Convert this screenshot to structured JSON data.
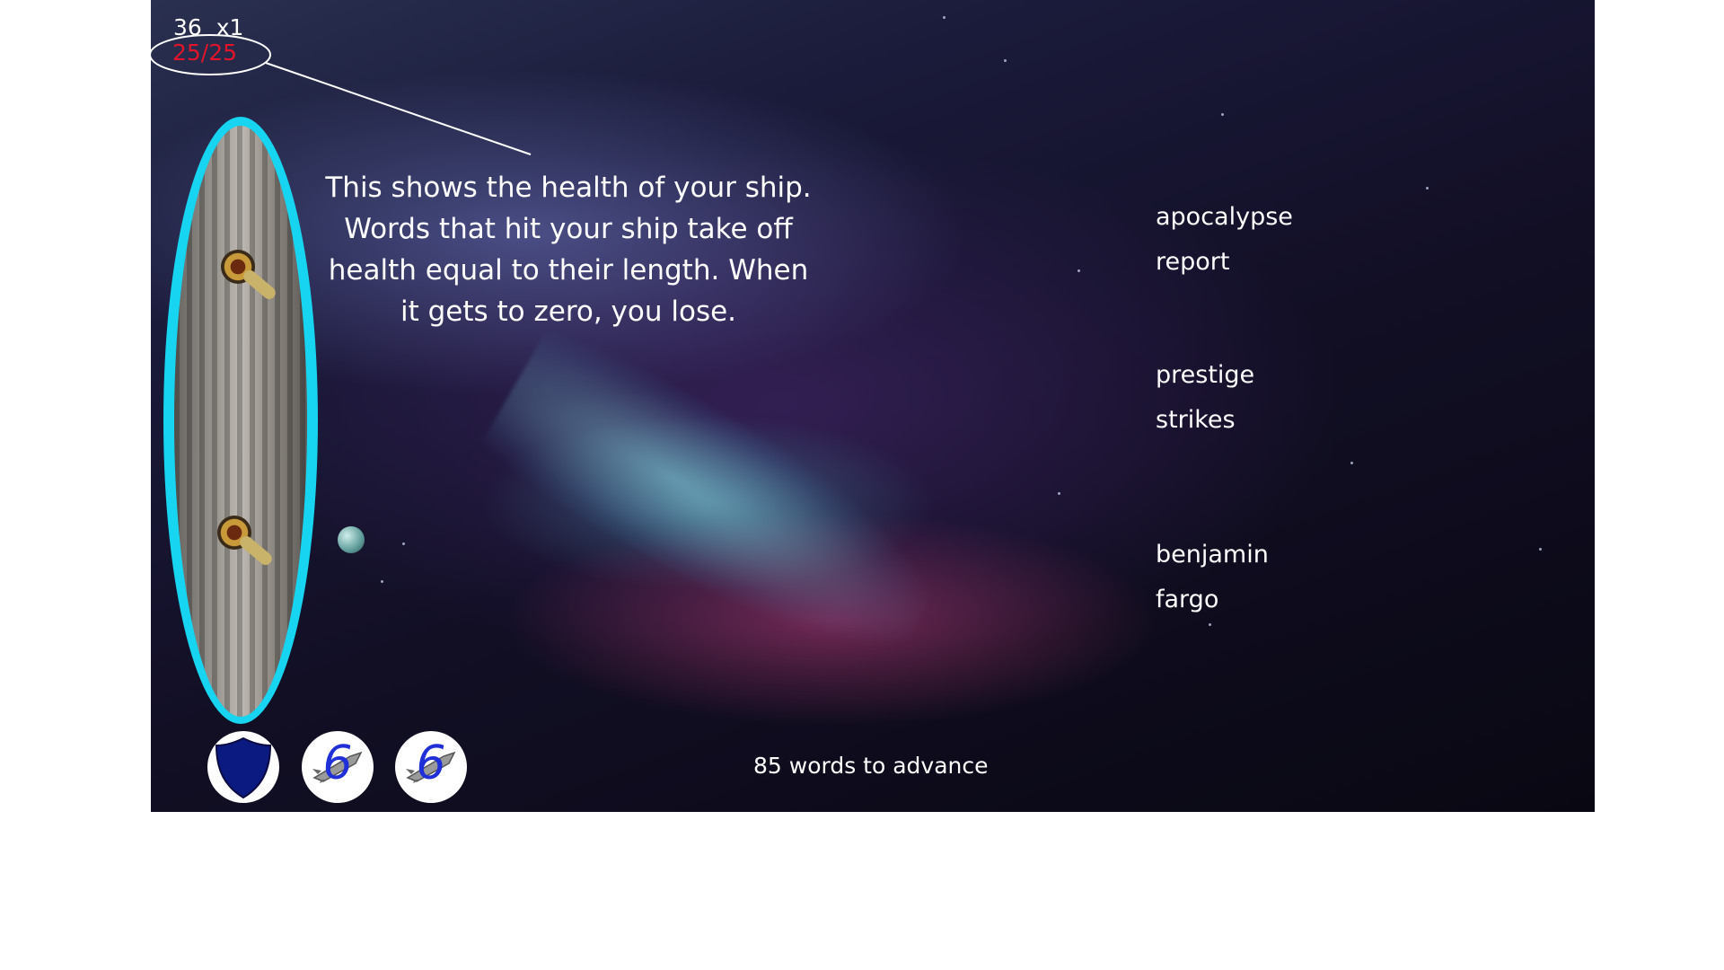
{
  "hud": {
    "score": "36",
    "multiplier": "x1",
    "health": "25/25"
  },
  "tutorial": {
    "lines": [
      "This shows the health of your ship.",
      "Words that hit your ship take off",
      "health equal to their length.  When",
      "it gets to zero, you lose."
    ]
  },
  "words": [
    "apocalypse",
    "report",
    "prestige",
    "strikes",
    "benjamin",
    "fargo"
  ],
  "powerups": [
    {
      "name": "shield-icon",
      "count": ""
    },
    {
      "name": "missile-icon",
      "count": "6"
    },
    {
      "name": "missile-icon",
      "count": "6"
    }
  ],
  "status": {
    "advance": "85 words to advance"
  },
  "colors": {
    "health_text": "#e0142a",
    "ship_shield": "#17d4f0",
    "powerup_count": "#2030d8",
    "shield_icon": "#0a1a80"
  }
}
